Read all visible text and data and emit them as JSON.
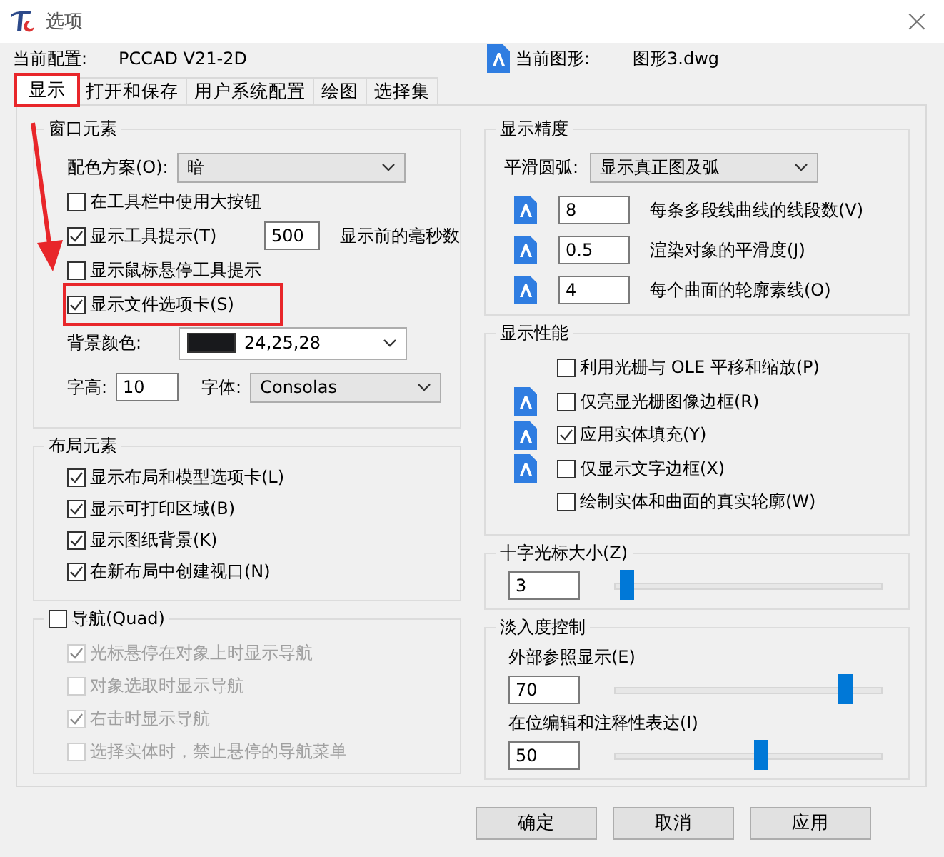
{
  "window": {
    "title": "选项",
    "close": "×"
  },
  "current_profile": {
    "label": "当前配置:",
    "value": "PCCAD V21-2D"
  },
  "current_drawing": {
    "label": "当前图形:",
    "value": "图形3.dwg"
  },
  "tabs": [
    {
      "label": "显示",
      "selected": true,
      "highlighted": true
    },
    {
      "label": "打开和保存",
      "selected": false,
      "highlighted": false
    },
    {
      "label": "用户系统配置",
      "selected": false,
      "highlighted": false
    },
    {
      "label": "绘图",
      "selected": false,
      "highlighted": false
    },
    {
      "label": "选择集",
      "selected": false,
      "highlighted": false
    }
  ],
  "arrow_annotation": true,
  "window_elements": {
    "title": "窗口元素",
    "color_scheme": {
      "label": "配色方案(O):",
      "value": "暗"
    },
    "checkboxes": [
      {
        "label": "在工具栏中使用大按钮",
        "checked": false,
        "highlighted": false
      },
      {
        "label": "显示工具提示(T)",
        "checked": true,
        "highlighted": false,
        "field": "500",
        "suffix": "显示前的毫秒数"
      },
      {
        "label": "显示鼠标悬停工具提示",
        "checked": false,
        "highlighted": false
      },
      {
        "label": "显示文件选项卡(S)",
        "checked": true,
        "highlighted": true
      }
    ],
    "background_color": {
      "label": "背景颜色:",
      "value": "24,25,28",
      "color": "#18191c"
    },
    "font_height": {
      "label": "字高:",
      "value": "10"
    },
    "font": {
      "label": "字体:",
      "value": "Consolas"
    }
  },
  "layout_elements": {
    "title": "布局元素",
    "checkboxes": [
      {
        "label": "显示布局和模型选项卡(L)",
        "checked": true
      },
      {
        "label": "显示可打印区域(B)",
        "checked": true
      },
      {
        "label": "显示图纸背景(K)",
        "checked": true
      },
      {
        "label": "在新布局中创建视口(N)",
        "checked": true
      }
    ]
  },
  "navigation": {
    "title": "导航(Quad)",
    "checked": false,
    "checkboxes": [
      {
        "label": "光标悬停在对象上时显示导航",
        "checked": true,
        "disabled": true
      },
      {
        "label": "对象选取时显示导航",
        "checked": false,
        "disabled": true
      },
      {
        "label": "右击时显示导航",
        "checked": true,
        "disabled": true
      },
      {
        "label": "选择实体时，禁止悬停的导航菜单",
        "checked": false,
        "disabled": true
      }
    ]
  },
  "display_resolution": {
    "title": "显示精度",
    "arc_smoothness": {
      "label": "平滑圆弧:",
      "value": "显示真正图及弧"
    },
    "fields": [
      {
        "value": "8",
        "label": "每条多段线曲线的线段数(V)",
        "icon": true
      },
      {
        "value": "0.5",
        "label": "渲染对象的平滑度(J)",
        "icon": true
      },
      {
        "value": "4",
        "label": "每个曲面的轮廓素线(O)",
        "icon": true
      }
    ]
  },
  "display_performance": {
    "title": "显示性能",
    "checkboxes": [
      {
        "label": "利用光栅与 OLE 平移和缩放(P)",
        "checked": false,
        "icon": false
      },
      {
        "label": "仅亮显光栅图像边框(R)",
        "checked": false,
        "icon": true
      },
      {
        "label": "应用实体填充(Y)",
        "checked": true,
        "icon": true
      },
      {
        "label": "仅显示文字边框(X)",
        "checked": false,
        "icon": true
      },
      {
        "label": "绘制实体和曲面的真实轮廓(W)",
        "checked": false,
        "icon": false
      }
    ]
  },
  "crosshair_size": {
    "title": "十字光标大小(Z)",
    "value": "3",
    "level": 0.02
  },
  "fade_control": {
    "title": "淡入度控制",
    "sliders": [
      {
        "label": "外部参照显示(E)",
        "value": "70",
        "level": 0.88
      },
      {
        "label": "在位编辑和注释性表达(I)",
        "value": "50",
        "level": 0.55
      }
    ]
  },
  "buttons": [
    "确定",
    "取消",
    "应用"
  ]
}
